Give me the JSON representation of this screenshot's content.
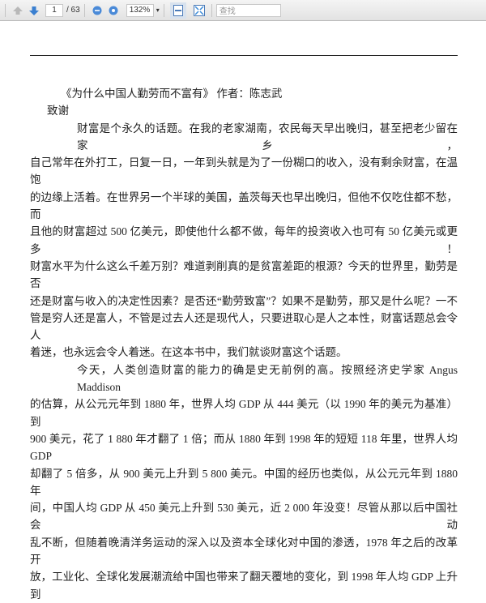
{
  "toolbar": {
    "page_current": "1",
    "page_total": "/ 63",
    "zoom": "132%",
    "search_placeholder": "查找",
    "icons": [
      "arrow-up-icon",
      "arrow-down-icon",
      "zoom-out-icon",
      "zoom-in-icon",
      "fit-width-icon",
      "fullscreen-icon"
    ]
  },
  "document": {
    "title_line": "《为什么中国人勤劳而不富有》 作者：陈志武",
    "heading": "致谢",
    "lines": [
      "财富是个永久的话题。在我的老家湖南，农民每天早出晚归，甚至把老少留在家乡，",
      "自己常年在外打工，日复一日，一年到头就是为了一份糊口的收入，没有剩余财富，在温饱",
      "的边缘上活着。在世界另一个半球的美国，盖茨每天也早出晚归，但他不仅吃住都不愁，而",
      "且他的财富超过 500 亿美元，即使他什么都不做，每年的投资收入也可有 50 亿美元或更多！",
      "财富水平为什么这么千差万别？难道剥削真的是贫富差距的根源？今天的世界里，勤劳是否",
      "还是财富与收入的决定性因素？是否还“勤劳致富”？如果不是勤劳，那又是什么呢？一不",
      "管是穷人还是富人，不管是过去人还是现代人，只要进取心是人之本性，财富话题总会令人",
      "着迷，也永远会令人着迷。在这本书中，我们就谈财富这个话题。",
      "今天，人类创造财富的能力的确是史无前例的高。按照经济史学家 Angus Maddison",
      "的估算，从公元元年到 1880 年，世界人均 GDP 从 444 美元（以 1990 年的美元为基准）到",
      "900 美元，花了 1 880 年才翻了 1 倍；而从 1880 年到 1998 年的短短 118 年里，世界人均 GDP",
      "却翻了 5 倍多，从 900 美元上升到 5  800 美元。中国的经历也类似，从公元元年到 1880 年",
      "间，中国人均 GDP 从 450 美元上升到 530 美元，近 2 000 年没变！尽管从那以后中国社会动",
      "乱不断，但随着晚清洋务运动的深入以及资本全球化对中国的渗透，1978  年之后的改革开",
      "放，工业化、全球化发展潮流给中国也带来了翻天覆地的变化，到 1998 年人均 GDP 上升到"
    ]
  }
}
